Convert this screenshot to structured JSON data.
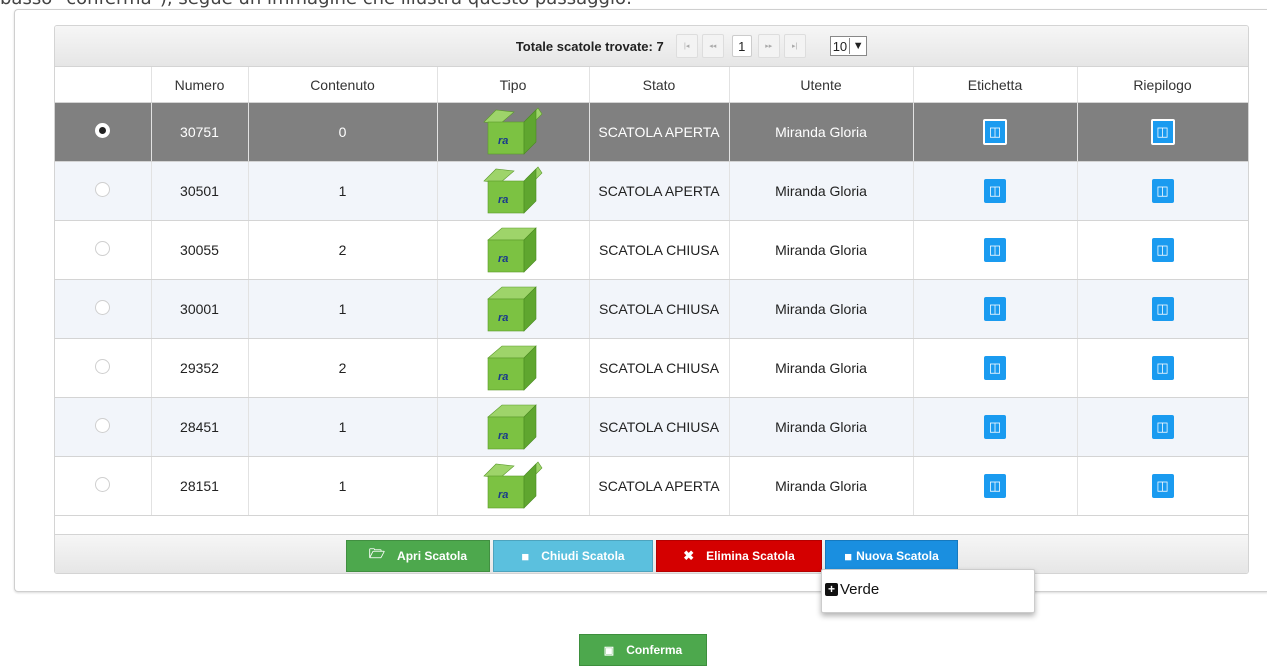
{
  "instruction_text": "basso \"conferma\"), segue un immagine che illustra questo passaggio:",
  "pager": {
    "total_label": "Totale scatole trovate: 7",
    "first": "|◂",
    "prev": "◂◂",
    "page": "1",
    "next": "▸▸",
    "last": "▸|",
    "page_size": "10"
  },
  "headers": [
    "",
    "Numero",
    "Contenuto",
    "Tipo",
    "Stato",
    "Utente",
    "Etichetta",
    "Riepilogo"
  ],
  "rows": [
    {
      "numero": "30751",
      "contenuto": "0",
      "tipo": "open",
      "stato": "SCATOLA APERTA",
      "utente": "Miranda Gloria",
      "selected": true
    },
    {
      "numero": "30501",
      "contenuto": "1",
      "tipo": "open",
      "stato": "SCATOLA APERTA",
      "utente": "Miranda Gloria",
      "selected": false
    },
    {
      "numero": "30055",
      "contenuto": "2",
      "tipo": "closed",
      "stato": "SCATOLA CHIUSA",
      "utente": "Miranda Gloria",
      "selected": false
    },
    {
      "numero": "30001",
      "contenuto": "1",
      "tipo": "closed",
      "stato": "SCATOLA CHIUSA",
      "utente": "Miranda Gloria",
      "selected": false
    },
    {
      "numero": "29352",
      "contenuto": "2",
      "tipo": "closed",
      "stato": "SCATOLA CHIUSA",
      "utente": "Miranda Gloria",
      "selected": false
    },
    {
      "numero": "28451",
      "contenuto": "1",
      "tipo": "closed",
      "stato": "SCATOLA CHIUSA",
      "utente": "Miranda Gloria",
      "selected": false
    },
    {
      "numero": "28151",
      "contenuto": "1",
      "tipo": "open",
      "stato": "SCATOLA APERTA",
      "utente": "Miranda Gloria",
      "selected": false
    }
  ],
  "pdf_icon": "pdf-icon",
  "box_logo": "ra",
  "actions": {
    "apri": "Apri Scatola",
    "chiudi": "Chiudi Scatola",
    "elimina": "Elimina Scatola",
    "nuova": "Nuova Scatola"
  },
  "dropdown": {
    "item": "Verde"
  },
  "confirm": "Conferma",
  "colors": {
    "selected_row": "#808080",
    "pdf_button": "#1a9bf0",
    "apri": "#4da84d",
    "chiudi": "#5bc0de",
    "elimina": "#d40000",
    "nuova": "#1a8fe0",
    "box_green": "#7cc242"
  }
}
